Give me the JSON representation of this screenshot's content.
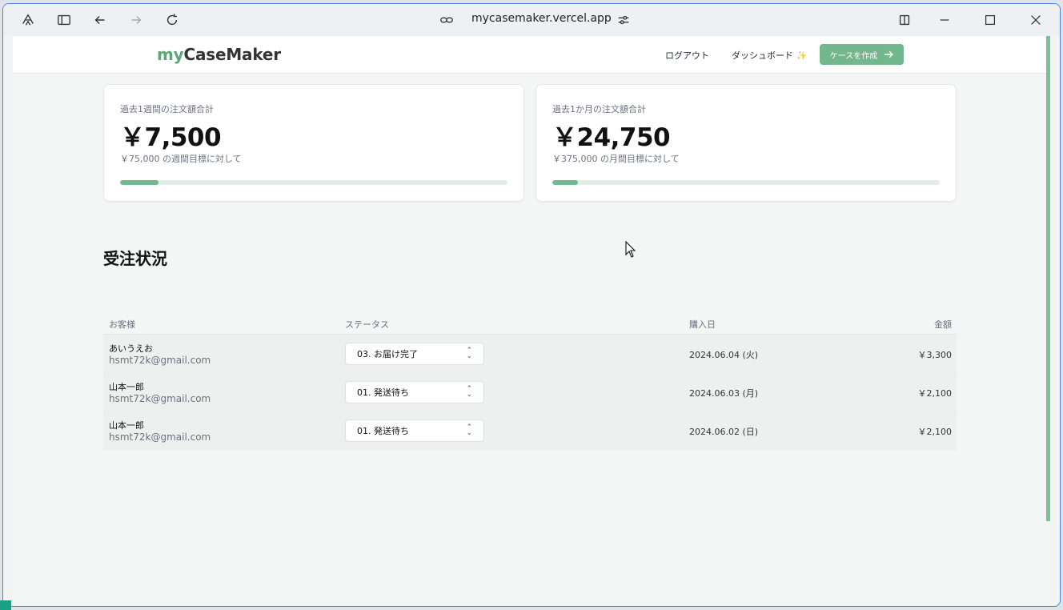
{
  "browser": {
    "url": "mycasemaker.vercel.app"
  },
  "nav": {
    "logo_prefix": "my",
    "logo_suffix": "CaseMaker",
    "logout": "ログアウト",
    "dashboard": "ダッシュボード ✨",
    "create_case": "ケースを作成"
  },
  "stats": {
    "weekly": {
      "label": "過去1週間の注文額合計",
      "value": "￥7,500",
      "target": "￥75,000 の週間目標に対して",
      "progress": 0.1
    },
    "monthly": {
      "label": "過去1か月の注文額合計",
      "value": "￥24,750",
      "target": "￥375,000 の月間目標に対して",
      "progress": 0.066
    }
  },
  "orders": {
    "title": "受注状況",
    "headers": {
      "customer": "お客様",
      "status": "ステータス",
      "date": "購入日",
      "amount": "金額"
    },
    "rows": [
      {
        "name": "あいうえお",
        "email": "hsmt72k@gmail.com",
        "status": "03. お届け完了",
        "date": "2024.06.04 (火)",
        "amount": "￥3,300"
      },
      {
        "name": "山本一郎",
        "email": "hsmt72k@gmail.com",
        "status": "01. 発送待ち",
        "date": "2024.06.03 (月)",
        "amount": "￥2,100"
      },
      {
        "name": "山本一郎",
        "email": "hsmt72k@gmail.com",
        "status": "01. 発送待ち",
        "date": "2024.06.02 (日)",
        "amount": "￥2,100"
      }
    ]
  },
  "colors": {
    "accent": "#72b78d",
    "progress_track": "#e2efe7"
  }
}
